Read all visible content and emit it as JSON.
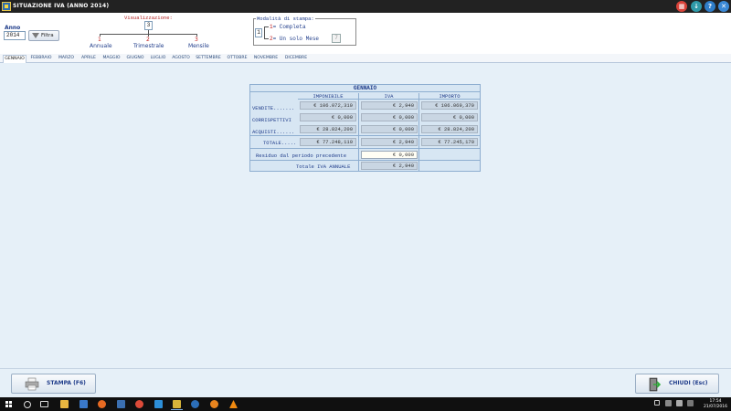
{
  "window": {
    "title": "SITUAZIONE IVA (ANNO 2014)"
  },
  "filter": {
    "anno_label": "Anno",
    "anno_value": "2014",
    "filtra_label": "Filtra"
  },
  "visualizzazione": {
    "label": "Visualizzazione:",
    "value": "3",
    "options": [
      {
        "num": "1",
        "label": "Annuale"
      },
      {
        "num": "2",
        "label": "Trimestrale"
      },
      {
        "num": "3",
        "label": "Mensile"
      }
    ]
  },
  "modalita": {
    "label": "Modalità di stampa:",
    "value": "1",
    "options": [
      {
        "num": "1",
        "label": "= Completa"
      },
      {
        "num": "2",
        "label": "= Un solo Mese"
      }
    ],
    "month_value": "7"
  },
  "tabs": [
    "GENNAIO",
    "FEBBRAIO",
    "MARZO",
    "APRILE",
    "MAGGIO",
    "GIUGNO",
    "LUGLIO",
    "AGOSTO",
    "SETTEMBRE",
    "OTTOBRE",
    "NOVEMBRE",
    "DICEMBRE"
  ],
  "active_tab": "GENNAIO",
  "panel": {
    "title": "GENNAIO",
    "columns": [
      "IMPONIBILE",
      "IVA",
      "IMPORTO"
    ],
    "rows": [
      {
        "label": "VENDITE.......",
        "imponibile": "€ 106.072,310",
        "iva": "€ 2,940",
        "importo": "€ 106.069,370"
      },
      {
        "label": "CORRISPETTIVI",
        "imponibile": "€ 0,000",
        "iva": "€ 0,000",
        "importo": "€ 0,000"
      },
      {
        "label": "ACQUISTI......",
        "imponibile": "€ 28.824,200",
        "iva": "€ 0,000",
        "importo": "€ 28.824,200"
      }
    ],
    "totale": {
      "label": "TOTALE.....",
      "imponibile": "€ 77.248,110",
      "iva": "€ 2,940",
      "importo": "€ 77.245,170"
    },
    "residuo": {
      "label": "Residuo dal periodo precedente",
      "value": "€ 0,000"
    },
    "totale_annuale": {
      "label": "Totale IVA ANNUALE",
      "value": "€ 2,940"
    }
  },
  "buttons": {
    "stampa": "STAMPA (F6)",
    "chiudi": "CHIUDI (Esc)"
  },
  "clock": {
    "time": "17:54",
    "date": "21/07/2016"
  },
  "colors": {
    "accent": "#1f3c8a",
    "red_label": "#c02020",
    "panel_bg": "#d7e6f3",
    "app_bg": "#e6f0f8"
  },
  "icons": {
    "titlebar": [
      "calculator-icon",
      "download-icon",
      "help-icon",
      "close-icon"
    ],
    "taskbar": [
      "start-icon",
      "search-icon",
      "task-view-icon",
      "file-explorer-icon",
      "store-icon",
      "firefox-icon",
      "chrome-icon",
      "edge-icon",
      "app-icon",
      "app-icon",
      "app-icon",
      "vlc-icon"
    ]
  }
}
